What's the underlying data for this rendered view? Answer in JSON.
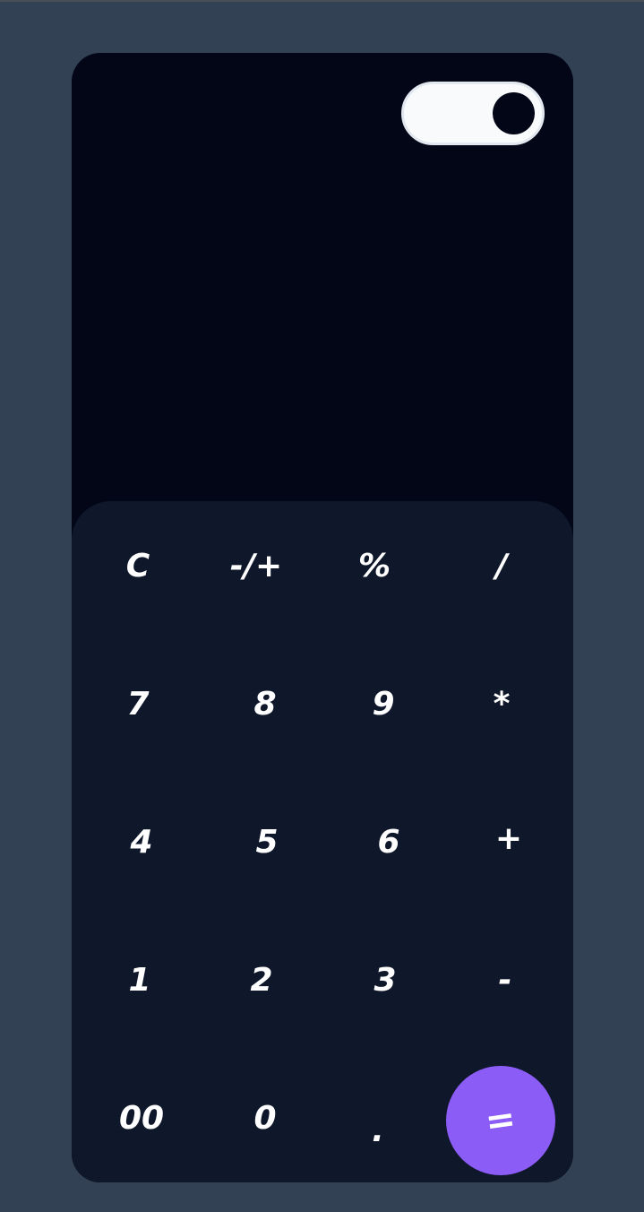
{
  "theme_toggle": {
    "state": "on"
  },
  "keypad": {
    "rows": [
      [
        "C",
        "-/+",
        "%",
        "/"
      ],
      [
        "7",
        "8",
        "9",
        "*"
      ],
      [
        "4",
        "5",
        "6",
        "+"
      ],
      [
        "1",
        "2",
        "3",
        "-"
      ],
      [
        "00",
        "0",
        "."
      ]
    ],
    "equals_label": "="
  },
  "colors": {
    "background": "#334155",
    "display": "#020617",
    "keypad": "#0f172a",
    "accent": "#8b5cf6",
    "key_text": "#ffffff"
  }
}
